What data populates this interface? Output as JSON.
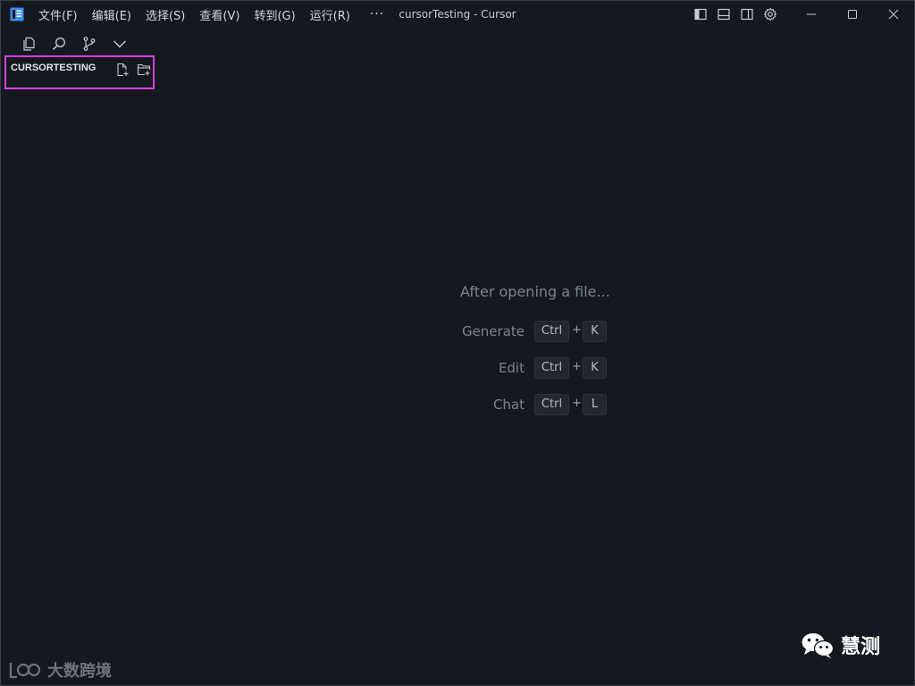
{
  "titlebar": {
    "title": "cursorTesting - Cursor",
    "menu": [
      "文件(F)",
      "编辑(E)",
      "选择(S)",
      "查看(V)",
      "转到(G)",
      "运行(R)"
    ],
    "more": "···"
  },
  "explorer": {
    "title": "CURSORTESTING"
  },
  "hints": {
    "title": "After opening a file...",
    "rows": [
      {
        "label": "Generate",
        "mod": "Ctrl",
        "plus": "+",
        "key": "K"
      },
      {
        "label": "Edit",
        "mod": "Ctrl",
        "plus": "+",
        "key": "K"
      },
      {
        "label": "Chat",
        "mod": "Ctrl",
        "plus": "+",
        "key": "L"
      }
    ]
  },
  "watermarks": {
    "left": "大数跨境",
    "right": "慧测"
  },
  "colors": {
    "background": "#141920",
    "highlight_border": "#d63ee0",
    "logo": "#3b8eea"
  },
  "icons": {
    "activity": [
      "files-icon",
      "search-icon",
      "source-control-icon",
      "chevron-down-icon"
    ],
    "explorer_actions": [
      "new-file-icon",
      "new-folder-icon"
    ],
    "layout": [
      "toggle-primary-sidebar-icon",
      "toggle-panel-icon",
      "toggle-secondary-sidebar-icon",
      "gear-icon"
    ],
    "window": [
      "minimize-icon",
      "maximize-icon",
      "close-icon"
    ]
  }
}
